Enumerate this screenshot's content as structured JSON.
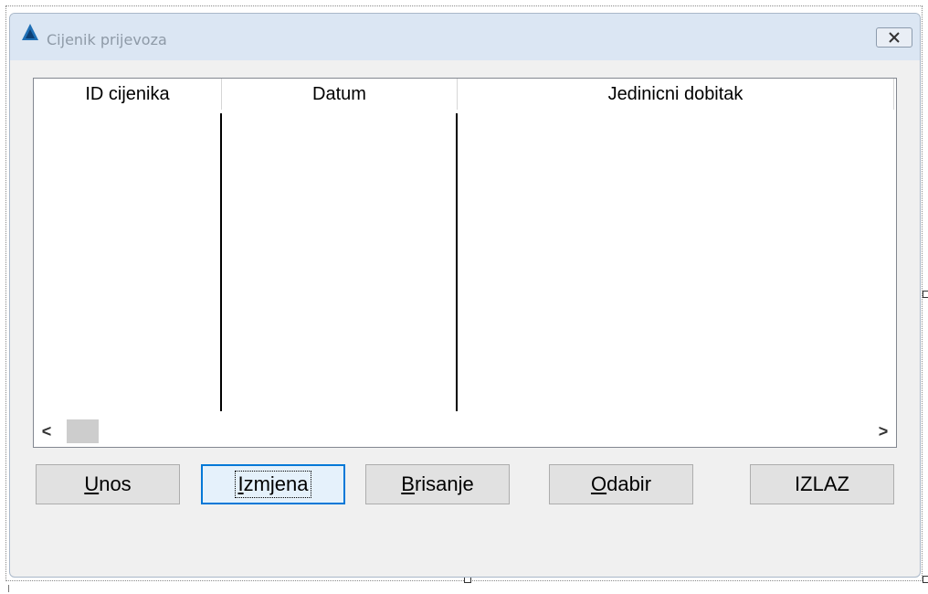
{
  "window": {
    "title": "Cijenik prijevoza",
    "close_icon": "close-x-icon"
  },
  "grid": {
    "columns": [
      "ID cijenika",
      "Datum",
      "Jedinicni dobitak"
    ],
    "rows": [],
    "scroll_left": "<",
    "scroll_right": ">"
  },
  "buttons": {
    "unos": {
      "mnemonic": "U",
      "rest": "nos"
    },
    "izmjena": {
      "mnemonic": "I",
      "rest": "zmjena"
    },
    "brisanje": {
      "mnemonic": "B",
      "rest": "risanje"
    },
    "odabir": {
      "mnemonic": "O",
      "rest": "dabir"
    },
    "izlaz": "IZLAZ"
  },
  "colors": {
    "titlebar": "#dbe6f3",
    "window_bg": "#f0f0f0",
    "focus_border": "#0078d7"
  }
}
